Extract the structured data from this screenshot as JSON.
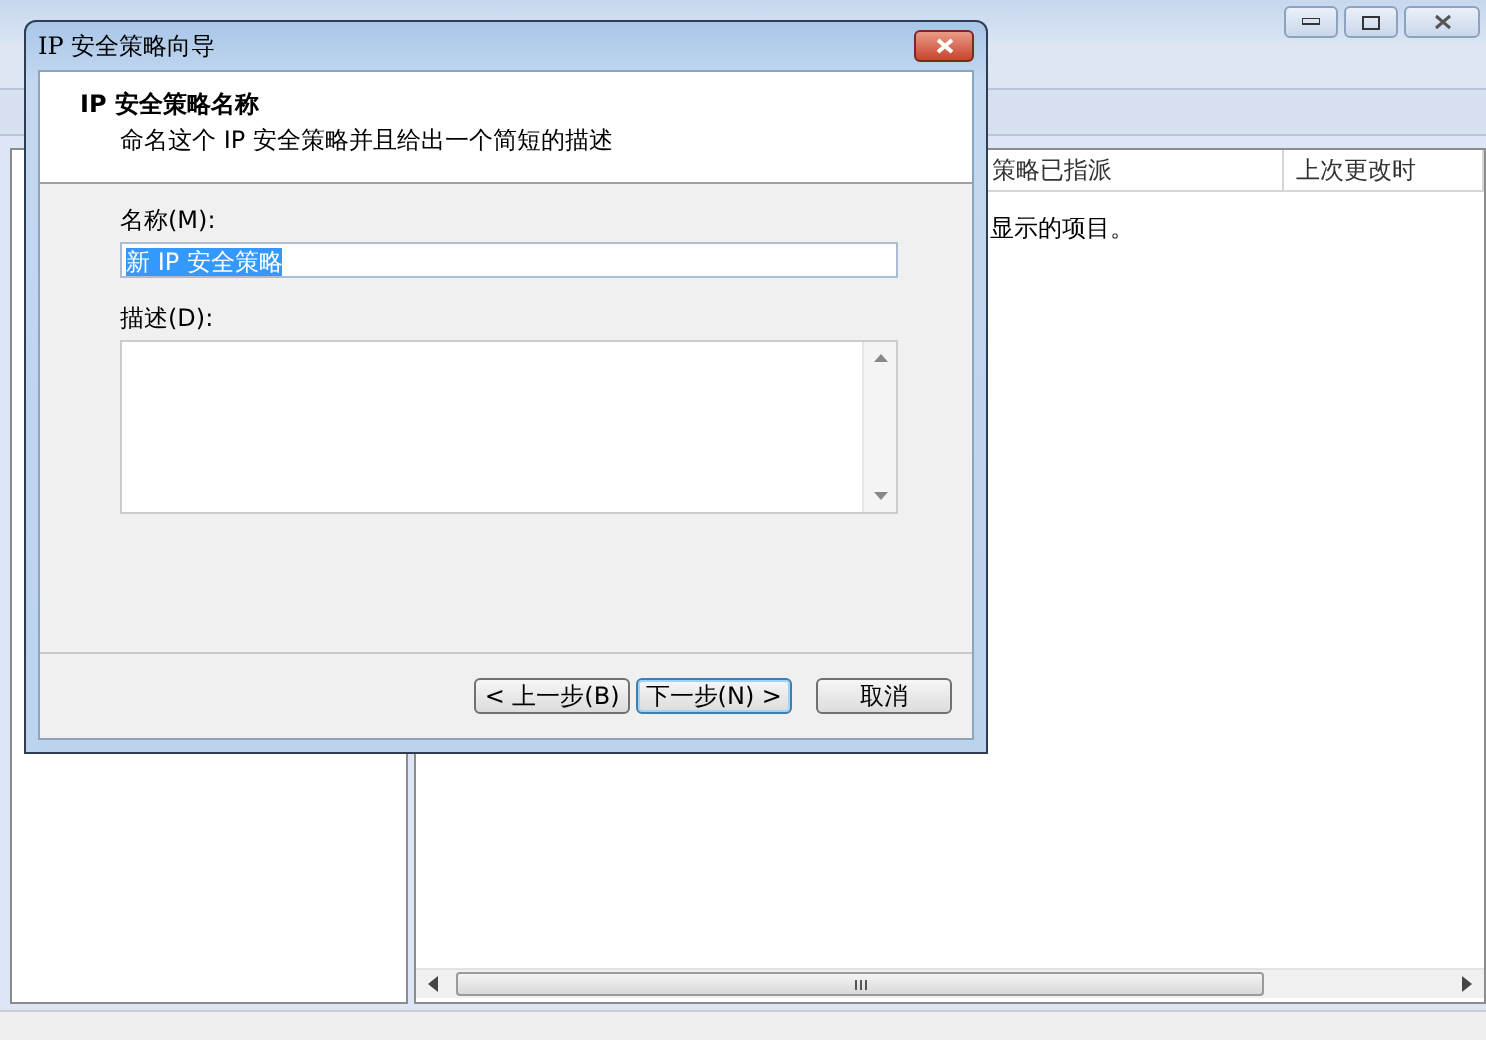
{
  "list": {
    "columns": [
      {},
      {
        "label": "策略已指派"
      },
      {
        "label": "上次更改时"
      }
    ],
    "empty_message": "显示的项目。"
  },
  "dialog": {
    "title": "IP 安全策略向导",
    "heading": "IP 安全策略名称",
    "subheading": "命名这个 IP 安全策略并且给出一个简短的描述",
    "name_label": "名称(M):",
    "name_value": "新 IP 安全策略",
    "name_selected": true,
    "description_label": "描述(D):",
    "buttons": [
      {
        "label": "< 上一步(B)",
        "kind": "back",
        "default": false
      },
      {
        "label": "下一步(N) >",
        "kind": "next",
        "default": true
      },
      {
        "label": "取消",
        "kind": "cancel",
        "default": false
      }
    ]
  }
}
